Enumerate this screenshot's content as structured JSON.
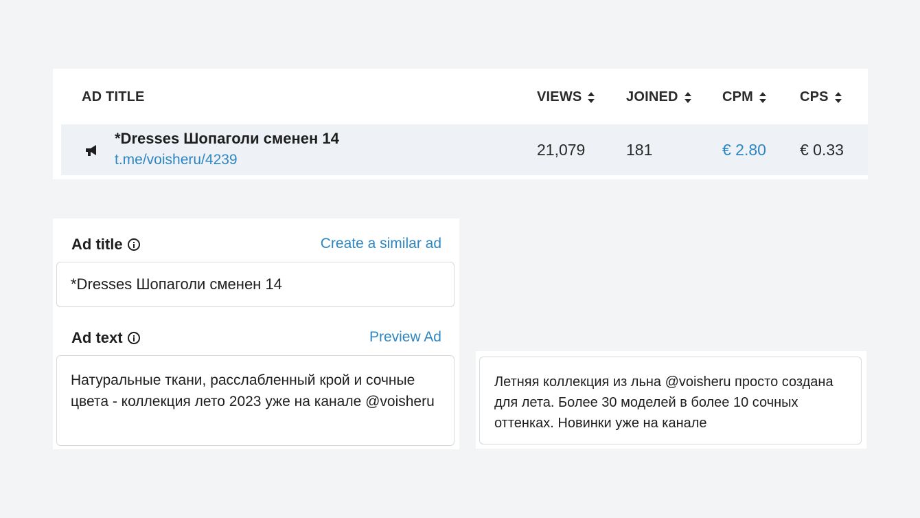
{
  "stats_table": {
    "headers": {
      "ad_title": "AD TITLE",
      "views": "VIEWS",
      "joined": "JOINED",
      "cpm": "CPM",
      "cps": "CPS"
    },
    "row": {
      "icon": "megaphone-icon",
      "title": "*Dresses Шопаголи сменен 14",
      "link": "t.me/voisheru/4239",
      "views": "21,079",
      "joined": "181",
      "cpm": "€ 2.80",
      "cps": "€ 0.33"
    }
  },
  "ad_form": {
    "title_label": "Ad title",
    "title_action": "Create a similar ad",
    "title_value": "*Dresses Шопаголи сменен 14",
    "text_label": "Ad text",
    "text_action": "Preview Ad",
    "text_value": "Натуральные ткани, расслабленный крой и сочные цвета - коллекция лето 2023 уже на канале @voisheru"
  },
  "alt_ad_text": "Летняя коллекция из льна @voisheru просто создана для лета. Более 30 моделей в более 10 сочных оттенках. Новинки уже на канале",
  "colors": {
    "accent_link": "#2e86c1",
    "row_highlight": "#eef2f6",
    "page_background": "#f3f4f6"
  }
}
